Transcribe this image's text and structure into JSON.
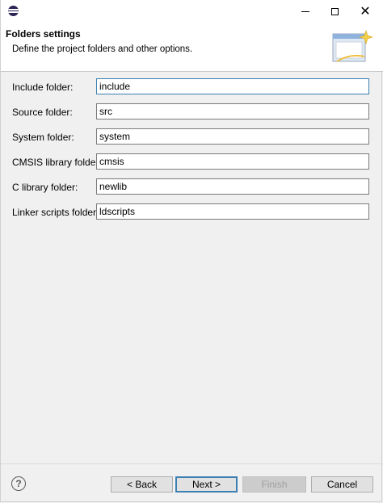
{
  "window": {
    "app_icon": "eclipse-icon",
    "controls": {
      "minimize": "minimize-icon",
      "maximize": "maximize-icon",
      "close": "close-icon"
    }
  },
  "header": {
    "title": "Folders  settings",
    "description": "Define the project folders and other options.",
    "banner_icon": "wizard-banner-icon"
  },
  "fields": [
    {
      "label": "Include folder:",
      "value": "include"
    },
    {
      "label": "Source folder:",
      "value": "src"
    },
    {
      "label": "System folder:",
      "value": "system"
    },
    {
      "label": "CMSIS library folder:",
      "value": "cmsis"
    },
    {
      "label": "C library folder:",
      "value": "newlib"
    },
    {
      "label": "Linker scripts folder:",
      "value": "ldscripts"
    }
  ],
  "footer": {
    "help_icon": "help-icon",
    "help_glyph": "?",
    "back_label": "< Back",
    "next_label": "Next >",
    "finish_label": "Finish",
    "cancel_label": "Cancel"
  },
  "colors": {
    "background": "#f0f0f0",
    "header_background": "#ffffff",
    "focus_border": "#3c7fb1"
  }
}
